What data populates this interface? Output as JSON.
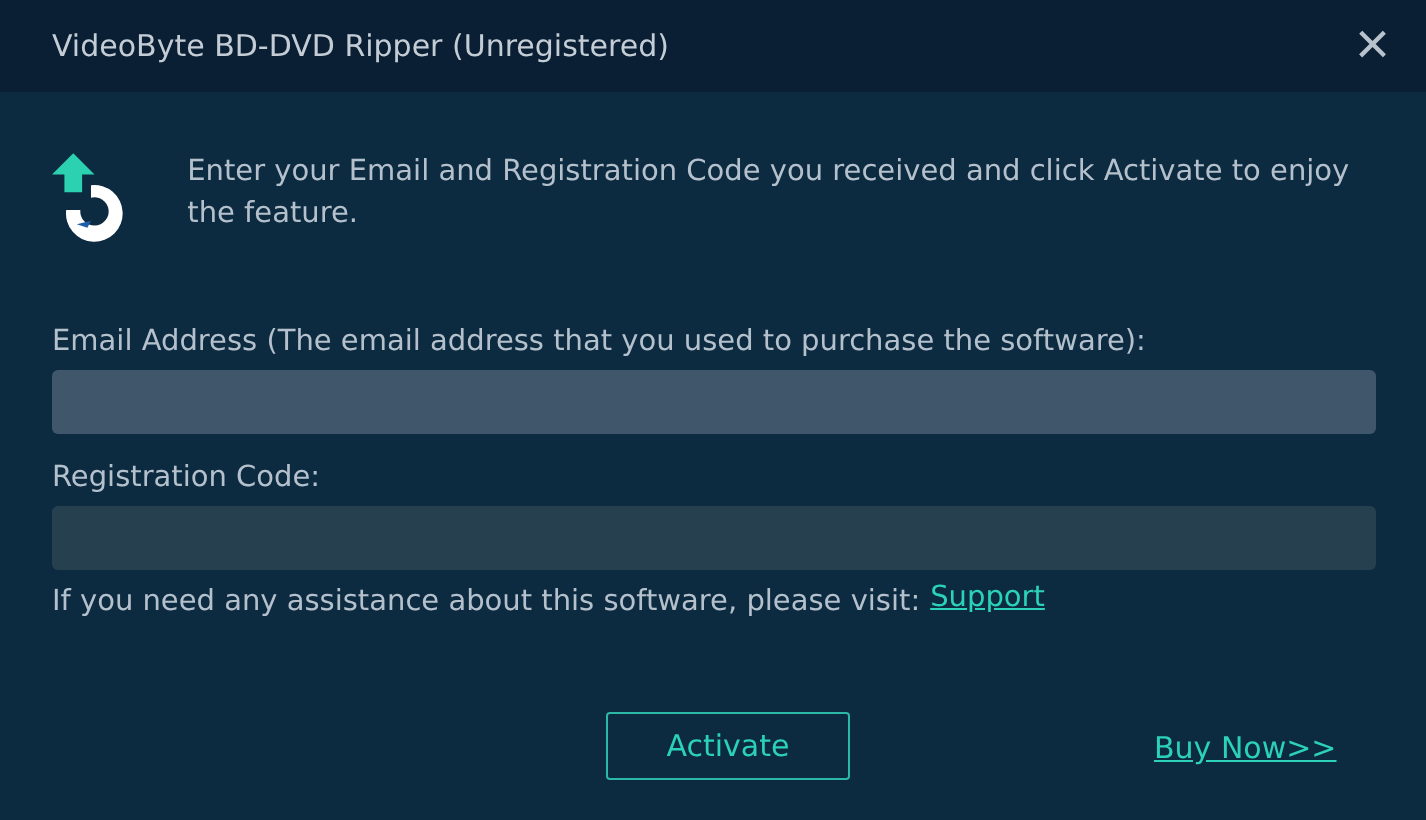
{
  "window": {
    "title": "VideoByte BD-DVD Ripper (Unregistered)",
    "close": "×"
  },
  "intro": "Enter your Email and Registration Code you received and click Activate to enjoy the feature.",
  "fields": [
    {
      "label": "Email Address (The email address that you used to purchase the software):",
      "focused": true
    },
    {
      "label": "Registration Code:",
      "focused": false
    }
  ],
  "help": {
    "text": "If you need any assistance about this software, please visit:",
    "link": "Support"
  },
  "activate_button": "Activate",
  "buy_link": "Buy Now>>"
}
